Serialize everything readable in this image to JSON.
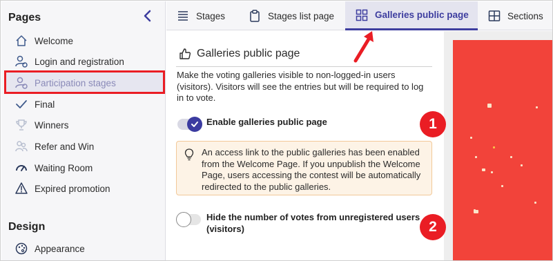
{
  "sidebar": {
    "heading": "Pages",
    "collapse_icon": "chevron-left-icon",
    "items": [
      {
        "label": "Welcome",
        "icon": "home-icon"
      },
      {
        "label": "Login and registration",
        "icon": "user-cog-icon"
      },
      {
        "label": "Participation stages",
        "icon": "user-plus-icon",
        "active": true
      },
      {
        "label": "Final",
        "icon": "check-icon"
      },
      {
        "label": "Winners",
        "icon": "trophy-icon"
      },
      {
        "label": "Refer and Win",
        "icon": "users-icon"
      },
      {
        "label": "Waiting Room",
        "icon": "gauge-icon"
      },
      {
        "label": "Expired promotion",
        "icon": "warning-icon"
      }
    ],
    "heading2": "Design",
    "items2": [
      {
        "label": "Appearance",
        "icon": "palette-icon"
      }
    ]
  },
  "tabs": [
    {
      "label": "Stages",
      "icon": "list-icon"
    },
    {
      "label": "Stages list page",
      "icon": "clipboard-icon"
    },
    {
      "label": "Galleries public page",
      "icon": "grid-icon",
      "active": true
    },
    {
      "label": "Sections",
      "icon": "layout-icon"
    }
  ],
  "main": {
    "title": "Galleries public page",
    "title_icon": "thumbs-up-icon",
    "description": "Make the voting galleries visible to non-logged-in users (visitors). Visitors will see the entries but will be required to log in to vote.",
    "toggle1": {
      "label": "Enable galleries public page",
      "enabled": true
    },
    "notice": {
      "icon": "lightbulb-icon",
      "text": "An access link to the public galleries has been enabled from the Welcome Page. If you unpublish the Welcome Page, users accessing the contest will be automatically redirected to the public galleries."
    },
    "toggle2": {
      "label": "Hide the number of votes from unregistered users (visitors)",
      "enabled": false
    }
  },
  "annotations": {
    "badge1": "1",
    "badge2": "2"
  },
  "colors": {
    "accent": "#3d3d9f",
    "annotation_red": "#ea1d24",
    "preview_red": "#f2433a",
    "notice_bg": "#fdf3e6"
  }
}
